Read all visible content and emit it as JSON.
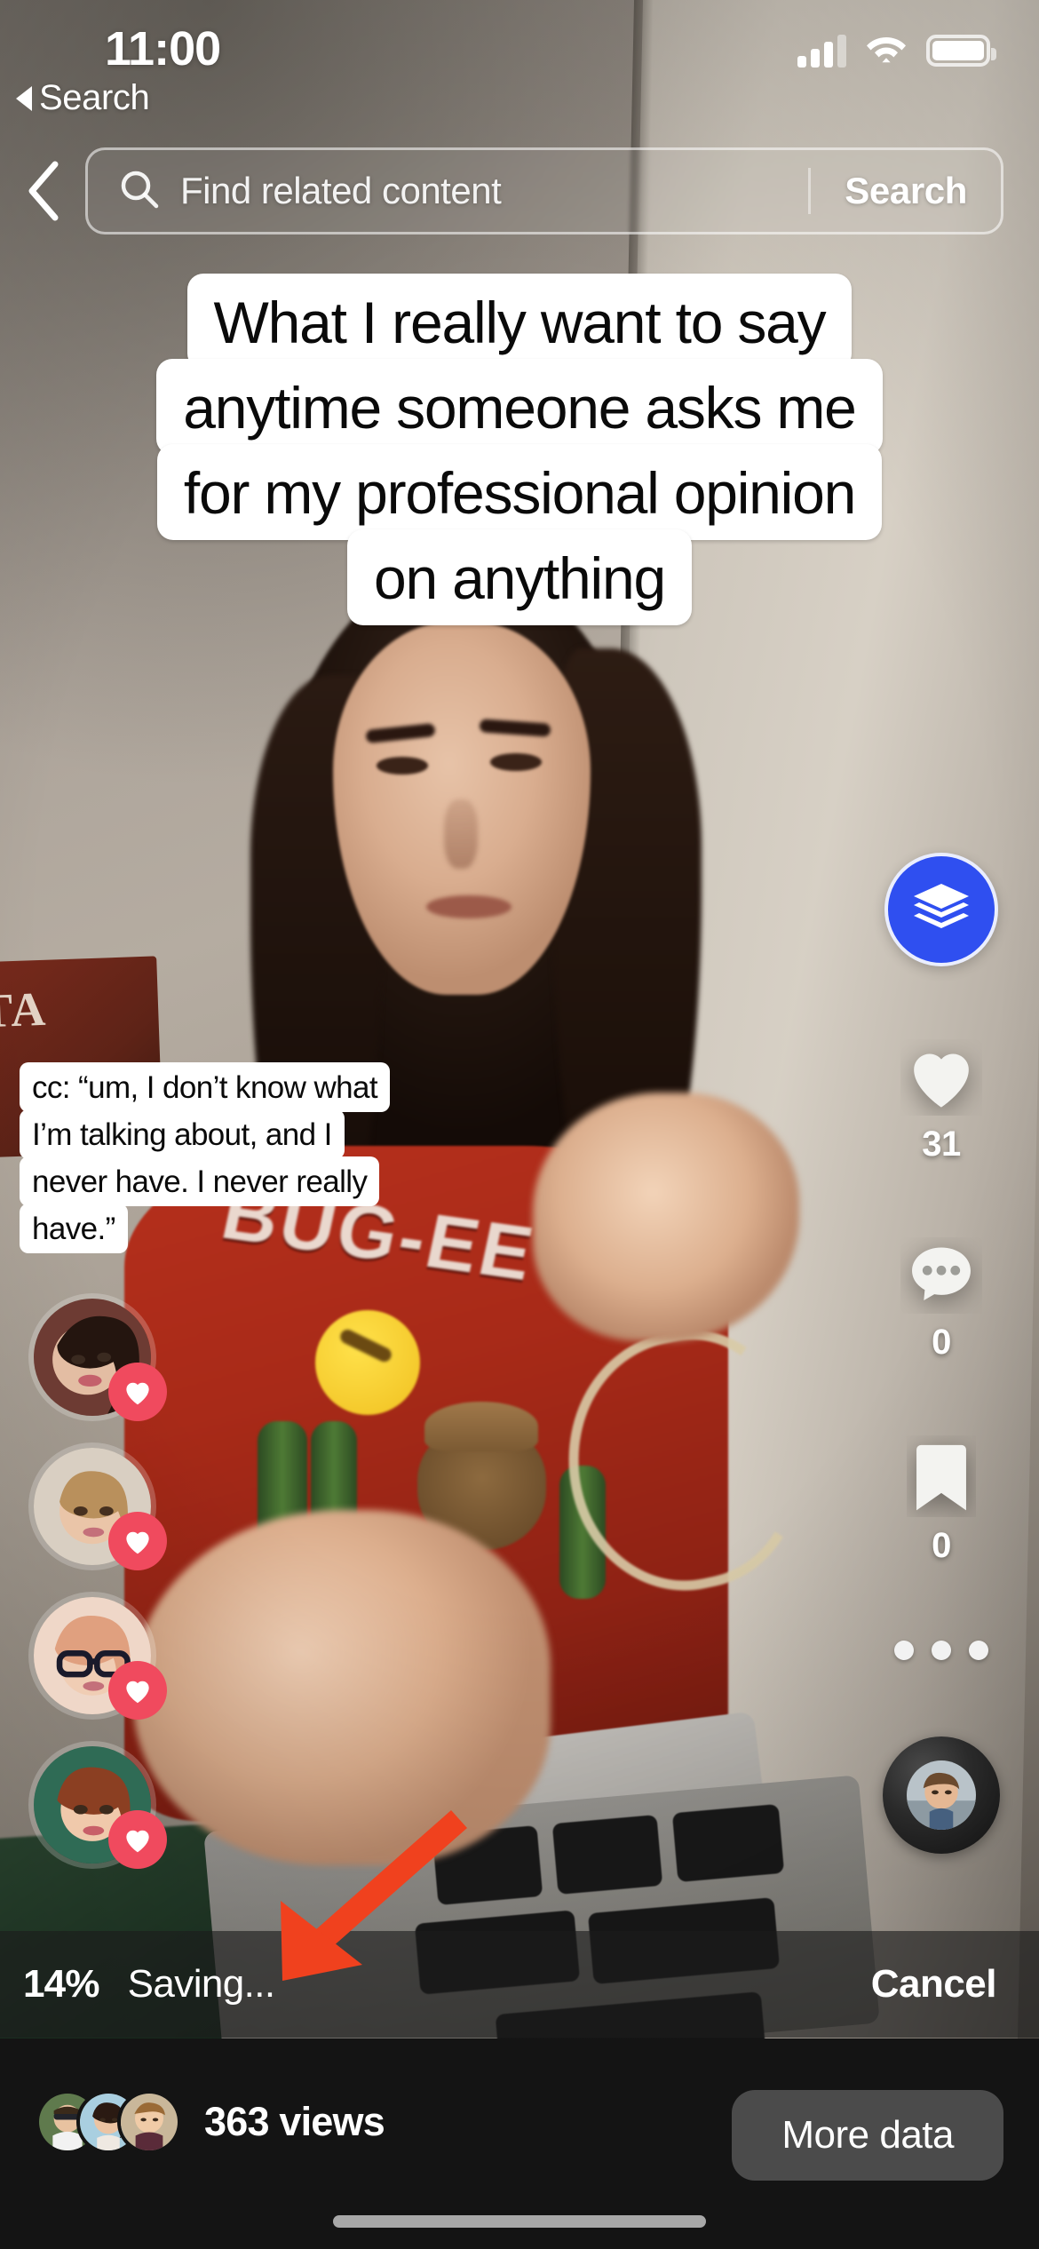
{
  "status_bar": {
    "time": "11:00",
    "back_label": "Search",
    "icons": [
      "cellular-signal-icon",
      "wifi-icon",
      "battery-icon"
    ]
  },
  "search": {
    "back_icon": "chevron-left-icon",
    "search_icon": "search-icon",
    "placeholder": "Find related content",
    "value": "",
    "submit_label": "Search"
  },
  "video_caption": {
    "lines": [
      "What I really want to say",
      "anytime someone asks me",
      "for my professional opinion",
      "on anything"
    ]
  },
  "closed_captions": {
    "lines": [
      "cc: “um, I don’t know what",
      "I’m talking about, and I",
      "never have. I never really",
      "have.”"
    ]
  },
  "liker_avatars": [
    {
      "name": "liker-avatar-1",
      "badge_icon": "heart-icon"
    },
    {
      "name": "liker-avatar-2",
      "badge_icon": "heart-icon"
    },
    {
      "name": "liker-avatar-3",
      "badge_icon": "heart-icon"
    },
    {
      "name": "liker-avatar-4",
      "badge_icon": "heart-icon"
    }
  ],
  "action_rail": {
    "buffer_button": {
      "icon": "layers-stack-icon",
      "color": "#2F4FF0"
    },
    "like": {
      "icon": "heart-icon",
      "count": "31"
    },
    "comment": {
      "icon": "comment-bubble-icon",
      "count": "0"
    },
    "bookmark": {
      "icon": "bookmark-icon",
      "count": "0"
    },
    "more": {
      "icon": "more-horizontal-icon"
    },
    "sound_disc": {
      "icon": "music-disc-avatar"
    }
  },
  "annotation": {
    "arrow_icon": "red-arrow-icon",
    "arrow_color": "#F0411E"
  },
  "saving_bar": {
    "percent": "14%",
    "status": "Saving...",
    "cancel_label": "Cancel",
    "progress_value": 14
  },
  "bottom_bar": {
    "viewer_avatar_count": 3,
    "views_label": "363 views",
    "more_data_label": "More data"
  },
  "home_indicator": {
    "name": "home-indicator"
  },
  "colors": {
    "accent_blue": "#2F4FF0",
    "heart_red": "#F04A5E",
    "arrow_orange": "#F0411E",
    "bottom_bar_bg": "#141414",
    "saving_bar_bg": "rgba(28,28,28,0.62)"
  }
}
